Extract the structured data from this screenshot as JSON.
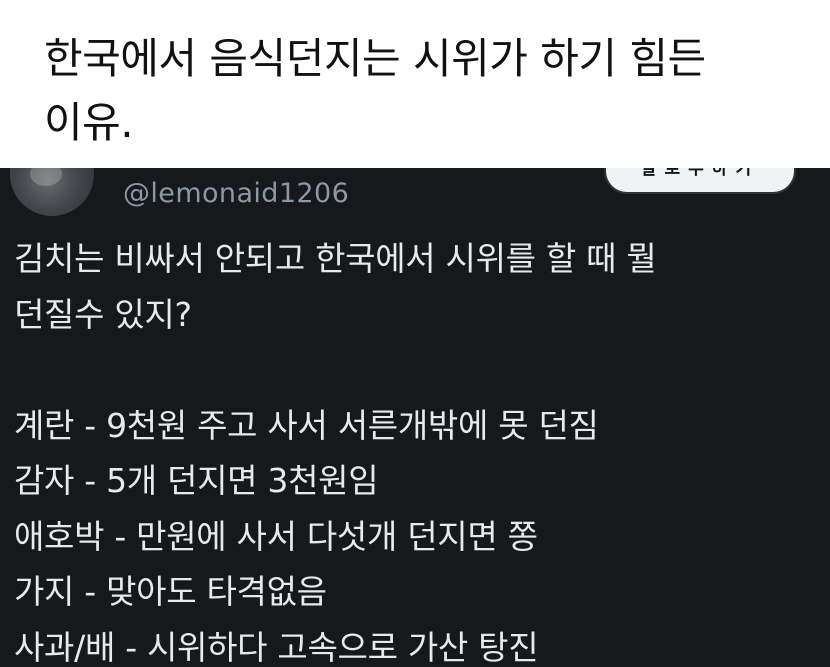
{
  "caption": {
    "lines": [
      "한국에서 음식던지는 시위가 하기 힘든",
      "이유."
    ]
  },
  "tweet": {
    "handle": "@lemonaid1206",
    "follow_button_label": "팔로우하기",
    "body_lines": [
      "김치는 비싸서 안되고 한국에서 시위를 할 때 뭘",
      "던질수 있지?",
      "",
      "계란 - 9천원 주고 사서 서른개밖에 못 던짐",
      "감자 - 5개 던지면 3천원임",
      "애호박 - 만원에 사서 다섯개 던지면 쫑",
      "가지 - 맞아도 타격없음",
      "사과/배 - 시위하다 고속으로 가산 탕진"
    ]
  },
  "icons": {
    "avatar": "profile-avatar"
  },
  "colors": {
    "caption_background": "#ffffff",
    "caption_text": "#111111",
    "tweet_background": "#16181c",
    "tweet_text": "#e7e9ea",
    "handle_text": "#8b98a5",
    "button_background": "#eff3f4"
  }
}
